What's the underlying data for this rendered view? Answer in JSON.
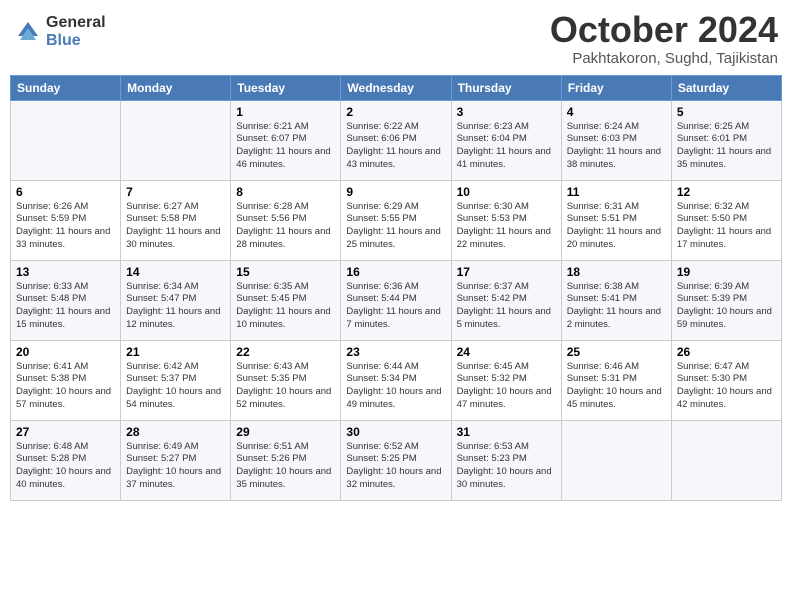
{
  "logo": {
    "general": "General",
    "blue": "Blue"
  },
  "title": {
    "month": "October 2024",
    "location": "Pakhtakoron, Sughd, Tajikistan"
  },
  "weekdays": [
    "Sunday",
    "Monday",
    "Tuesday",
    "Wednesday",
    "Thursday",
    "Friday",
    "Saturday"
  ],
  "weeks": [
    [
      {
        "day": "",
        "info": ""
      },
      {
        "day": "",
        "info": ""
      },
      {
        "day": "1",
        "info": "Sunrise: 6:21 AM\nSunset: 6:07 PM\nDaylight: 11 hours and 46 minutes."
      },
      {
        "day": "2",
        "info": "Sunrise: 6:22 AM\nSunset: 6:06 PM\nDaylight: 11 hours and 43 minutes."
      },
      {
        "day": "3",
        "info": "Sunrise: 6:23 AM\nSunset: 6:04 PM\nDaylight: 11 hours and 41 minutes."
      },
      {
        "day": "4",
        "info": "Sunrise: 6:24 AM\nSunset: 6:03 PM\nDaylight: 11 hours and 38 minutes."
      },
      {
        "day": "5",
        "info": "Sunrise: 6:25 AM\nSunset: 6:01 PM\nDaylight: 11 hours and 35 minutes."
      }
    ],
    [
      {
        "day": "6",
        "info": "Sunrise: 6:26 AM\nSunset: 5:59 PM\nDaylight: 11 hours and 33 minutes."
      },
      {
        "day": "7",
        "info": "Sunrise: 6:27 AM\nSunset: 5:58 PM\nDaylight: 11 hours and 30 minutes."
      },
      {
        "day": "8",
        "info": "Sunrise: 6:28 AM\nSunset: 5:56 PM\nDaylight: 11 hours and 28 minutes."
      },
      {
        "day": "9",
        "info": "Sunrise: 6:29 AM\nSunset: 5:55 PM\nDaylight: 11 hours and 25 minutes."
      },
      {
        "day": "10",
        "info": "Sunrise: 6:30 AM\nSunset: 5:53 PM\nDaylight: 11 hours and 22 minutes."
      },
      {
        "day": "11",
        "info": "Sunrise: 6:31 AM\nSunset: 5:51 PM\nDaylight: 11 hours and 20 minutes."
      },
      {
        "day": "12",
        "info": "Sunrise: 6:32 AM\nSunset: 5:50 PM\nDaylight: 11 hours and 17 minutes."
      }
    ],
    [
      {
        "day": "13",
        "info": "Sunrise: 6:33 AM\nSunset: 5:48 PM\nDaylight: 11 hours and 15 minutes."
      },
      {
        "day": "14",
        "info": "Sunrise: 6:34 AM\nSunset: 5:47 PM\nDaylight: 11 hours and 12 minutes."
      },
      {
        "day": "15",
        "info": "Sunrise: 6:35 AM\nSunset: 5:45 PM\nDaylight: 11 hours and 10 minutes."
      },
      {
        "day": "16",
        "info": "Sunrise: 6:36 AM\nSunset: 5:44 PM\nDaylight: 11 hours and 7 minutes."
      },
      {
        "day": "17",
        "info": "Sunrise: 6:37 AM\nSunset: 5:42 PM\nDaylight: 11 hours and 5 minutes."
      },
      {
        "day": "18",
        "info": "Sunrise: 6:38 AM\nSunset: 5:41 PM\nDaylight: 11 hours and 2 minutes."
      },
      {
        "day": "19",
        "info": "Sunrise: 6:39 AM\nSunset: 5:39 PM\nDaylight: 10 hours and 59 minutes."
      }
    ],
    [
      {
        "day": "20",
        "info": "Sunrise: 6:41 AM\nSunset: 5:38 PM\nDaylight: 10 hours and 57 minutes."
      },
      {
        "day": "21",
        "info": "Sunrise: 6:42 AM\nSunset: 5:37 PM\nDaylight: 10 hours and 54 minutes."
      },
      {
        "day": "22",
        "info": "Sunrise: 6:43 AM\nSunset: 5:35 PM\nDaylight: 10 hours and 52 minutes."
      },
      {
        "day": "23",
        "info": "Sunrise: 6:44 AM\nSunset: 5:34 PM\nDaylight: 10 hours and 49 minutes."
      },
      {
        "day": "24",
        "info": "Sunrise: 6:45 AM\nSunset: 5:32 PM\nDaylight: 10 hours and 47 minutes."
      },
      {
        "day": "25",
        "info": "Sunrise: 6:46 AM\nSunset: 5:31 PM\nDaylight: 10 hours and 45 minutes."
      },
      {
        "day": "26",
        "info": "Sunrise: 6:47 AM\nSunset: 5:30 PM\nDaylight: 10 hours and 42 minutes."
      }
    ],
    [
      {
        "day": "27",
        "info": "Sunrise: 6:48 AM\nSunset: 5:28 PM\nDaylight: 10 hours and 40 minutes."
      },
      {
        "day": "28",
        "info": "Sunrise: 6:49 AM\nSunset: 5:27 PM\nDaylight: 10 hours and 37 minutes."
      },
      {
        "day": "29",
        "info": "Sunrise: 6:51 AM\nSunset: 5:26 PM\nDaylight: 10 hours and 35 minutes."
      },
      {
        "day": "30",
        "info": "Sunrise: 6:52 AM\nSunset: 5:25 PM\nDaylight: 10 hours and 32 minutes."
      },
      {
        "day": "31",
        "info": "Sunrise: 6:53 AM\nSunset: 5:23 PM\nDaylight: 10 hours and 30 minutes."
      },
      {
        "day": "",
        "info": ""
      },
      {
        "day": "",
        "info": ""
      }
    ]
  ]
}
